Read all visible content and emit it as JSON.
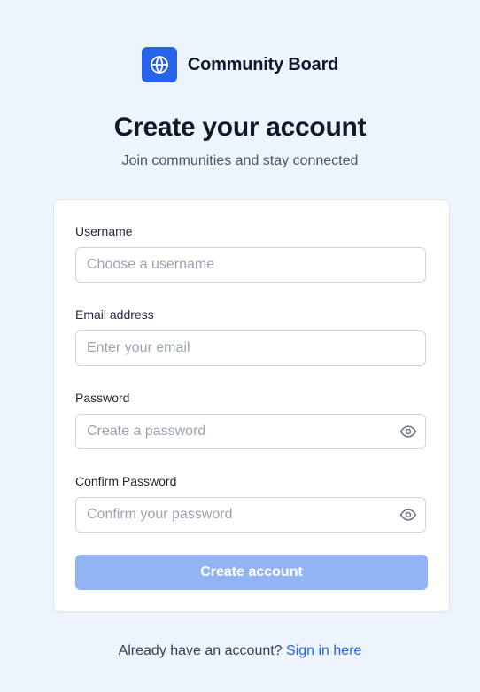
{
  "brand": {
    "name": "Community Board",
    "logo_icon": "globe-icon",
    "logo_color": "#2563eb"
  },
  "header": {
    "title": "Create your account",
    "subtitle": "Join communities and stay connected"
  },
  "form": {
    "fields": [
      {
        "label": "Username",
        "placeholder": "Choose a username",
        "value": ""
      },
      {
        "label": "Email address",
        "placeholder": "Enter your email",
        "value": ""
      },
      {
        "label": "Password",
        "placeholder": "Create a password",
        "value": "",
        "icon": "eye-icon"
      },
      {
        "label": "Confirm Password",
        "placeholder": "Confirm your password",
        "value": "",
        "icon": "eye-icon"
      }
    ],
    "submit_label": "Create account",
    "submit_color": "#93b4f4"
  },
  "footer": {
    "prompt": "Already have an account?",
    "link_label": "Sign in here",
    "link_color": "#2563eb"
  }
}
